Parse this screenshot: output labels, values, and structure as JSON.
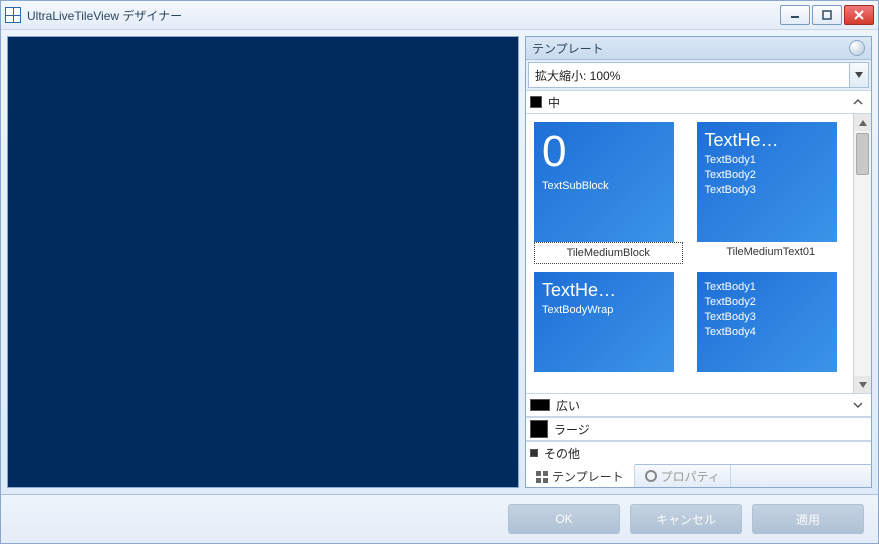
{
  "window": {
    "title": "UltraLiveTileView デザイナー"
  },
  "side": {
    "header": "テンプレート",
    "zoom_label": "拡大縮小: 100%",
    "categories": {
      "medium": "中",
      "wide": "広い",
      "large": "ラージ",
      "other": "その他"
    }
  },
  "tiles": {
    "block": {
      "num": "0",
      "sub": "TextSubBlock",
      "label": "TileMediumBlock"
    },
    "text01": {
      "heading": "TextHe…",
      "body1": "TextBody1",
      "body2": "TextBody2",
      "body3": "TextBody3",
      "label": "TileMediumText01"
    },
    "wrap": {
      "heading": "TextHe…",
      "body": "TextBodyWrap"
    },
    "four": {
      "body1": "TextBody1",
      "body2": "TextBody2",
      "body3": "TextBody3",
      "body4": "TextBody4"
    }
  },
  "tabs": {
    "templates": "テンプレート",
    "properties": "プロパティ"
  },
  "footer": {
    "ok": "OK",
    "cancel": "キャンセル",
    "apply": "適用"
  }
}
